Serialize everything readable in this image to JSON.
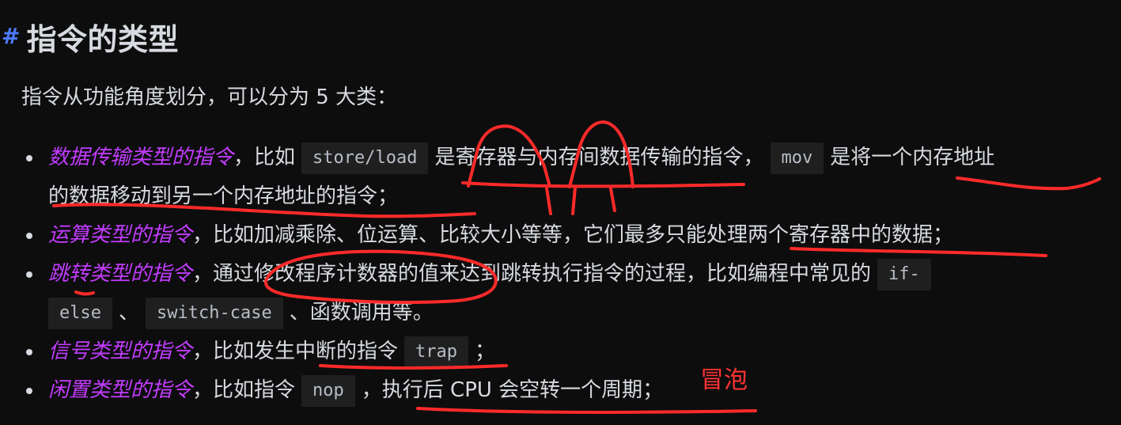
{
  "heading": {
    "hash": "#",
    "title": "指令的类型"
  },
  "intro": "指令从功能角度划分，可以分为 5 大类：",
  "list": [
    {
      "lead": "数据传输类型的指令",
      "parts": [
        "，比如",
        "store/load",
        "是寄存器与内存间数据传输的指令，",
        "mov",
        "是将一个内存地址",
        "的数据移动到另一个内存地址的指令；"
      ]
    },
    {
      "lead": "运算类型的指令",
      "text": "，比如加减乘除、位运算、比较大小等等，它们最多只能处理两个寄存器中的数据；"
    },
    {
      "lead": "跳转类型的指令",
      "parts": [
        "，通过修改程序计数器的值来达到跳转执行指令的过程，比如编程中常见的",
        "if-",
        "else",
        "、",
        "switch-case",
        "、函数调用等。"
      ]
    },
    {
      "lead": "信号类型的指令",
      "parts": [
        "，比如发生中断的指令",
        "trap",
        "；"
      ]
    },
    {
      "lead": "闲置类型的指令",
      "parts": [
        "，比如指令",
        "nop",
        "，执行后 CPU 会空转一个周期；"
      ]
    }
  ],
  "annotation": {
    "label": "冒泡",
    "color": "#ff3333"
  }
}
